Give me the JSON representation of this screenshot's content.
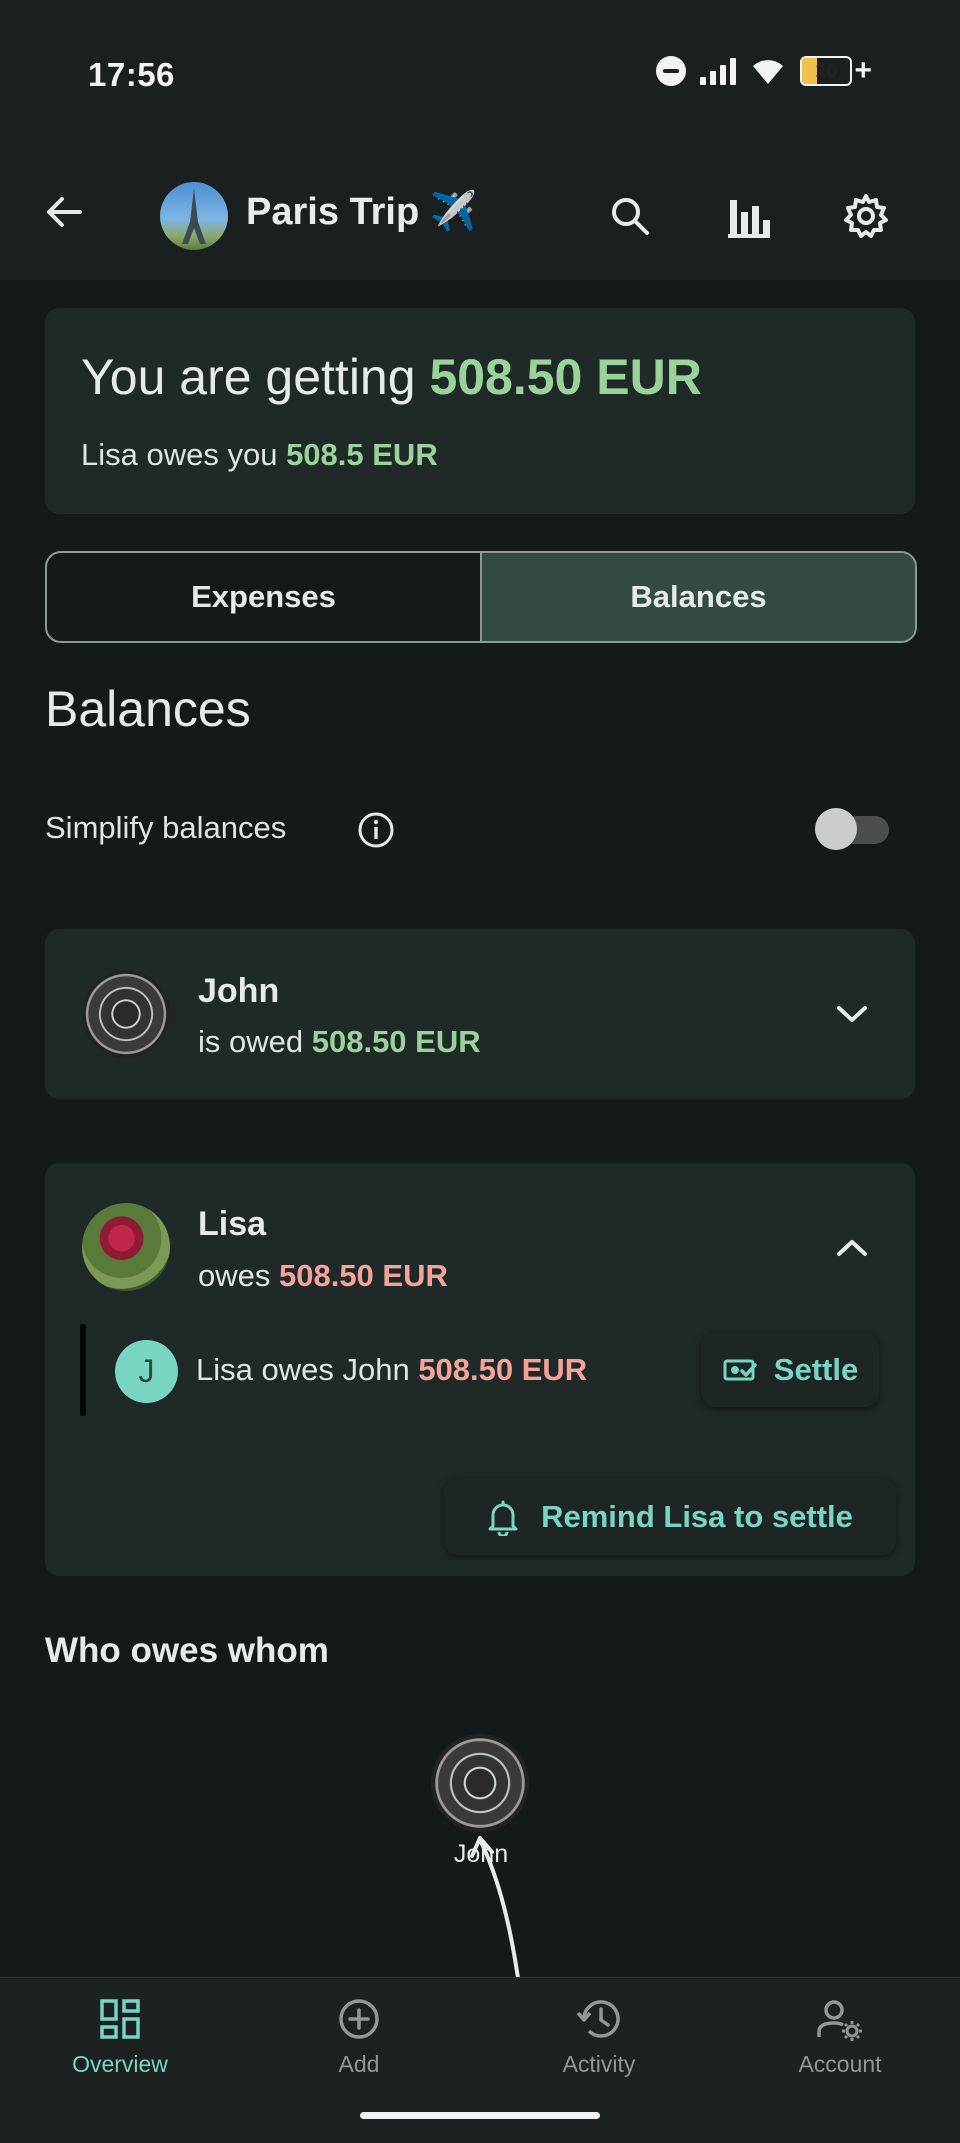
{
  "status_bar": {
    "time": "17:56",
    "battery": "10"
  },
  "header": {
    "title": "Paris Trip ✈️"
  },
  "summary": {
    "prefix": "You are getting ",
    "amount": "508.50 EUR",
    "sub_prefix": "Lisa owes you ",
    "sub_amount": "508.5 EUR"
  },
  "tabs": [
    {
      "label": "Expenses",
      "active": false
    },
    {
      "label": "Balances",
      "active": true
    }
  ],
  "balances": {
    "title": "Balances",
    "simplify_label": "Simplify balances",
    "simplify_enabled": false,
    "people": [
      {
        "name": "John",
        "status": "is owed ",
        "amount": "508.50 EUR",
        "expanded": false
      },
      {
        "name": "Lisa",
        "status": "owes ",
        "amount": "508.50 EUR",
        "expanded": true
      }
    ],
    "debt": {
      "avatar_letter": "J",
      "text": "Lisa owes John ",
      "amount": "508.50 EUR",
      "settle_label": "Settle"
    },
    "remind_label": "Remind Lisa to settle"
  },
  "who_owes_whom": {
    "title": "Who owes whom",
    "node_name": "John"
  },
  "colors": {
    "accent": "#7ad4c2",
    "positive": "#9ad39a",
    "negative": "#f4a39b"
  },
  "bottom_nav": [
    {
      "label": "Overview",
      "icon": "grid-icon",
      "active": true
    },
    {
      "label": "Add",
      "icon": "plus-circle-icon",
      "active": false
    },
    {
      "label": "Activity",
      "icon": "history-icon",
      "active": false
    },
    {
      "label": "Account",
      "icon": "account-settings-icon",
      "active": false
    }
  ]
}
